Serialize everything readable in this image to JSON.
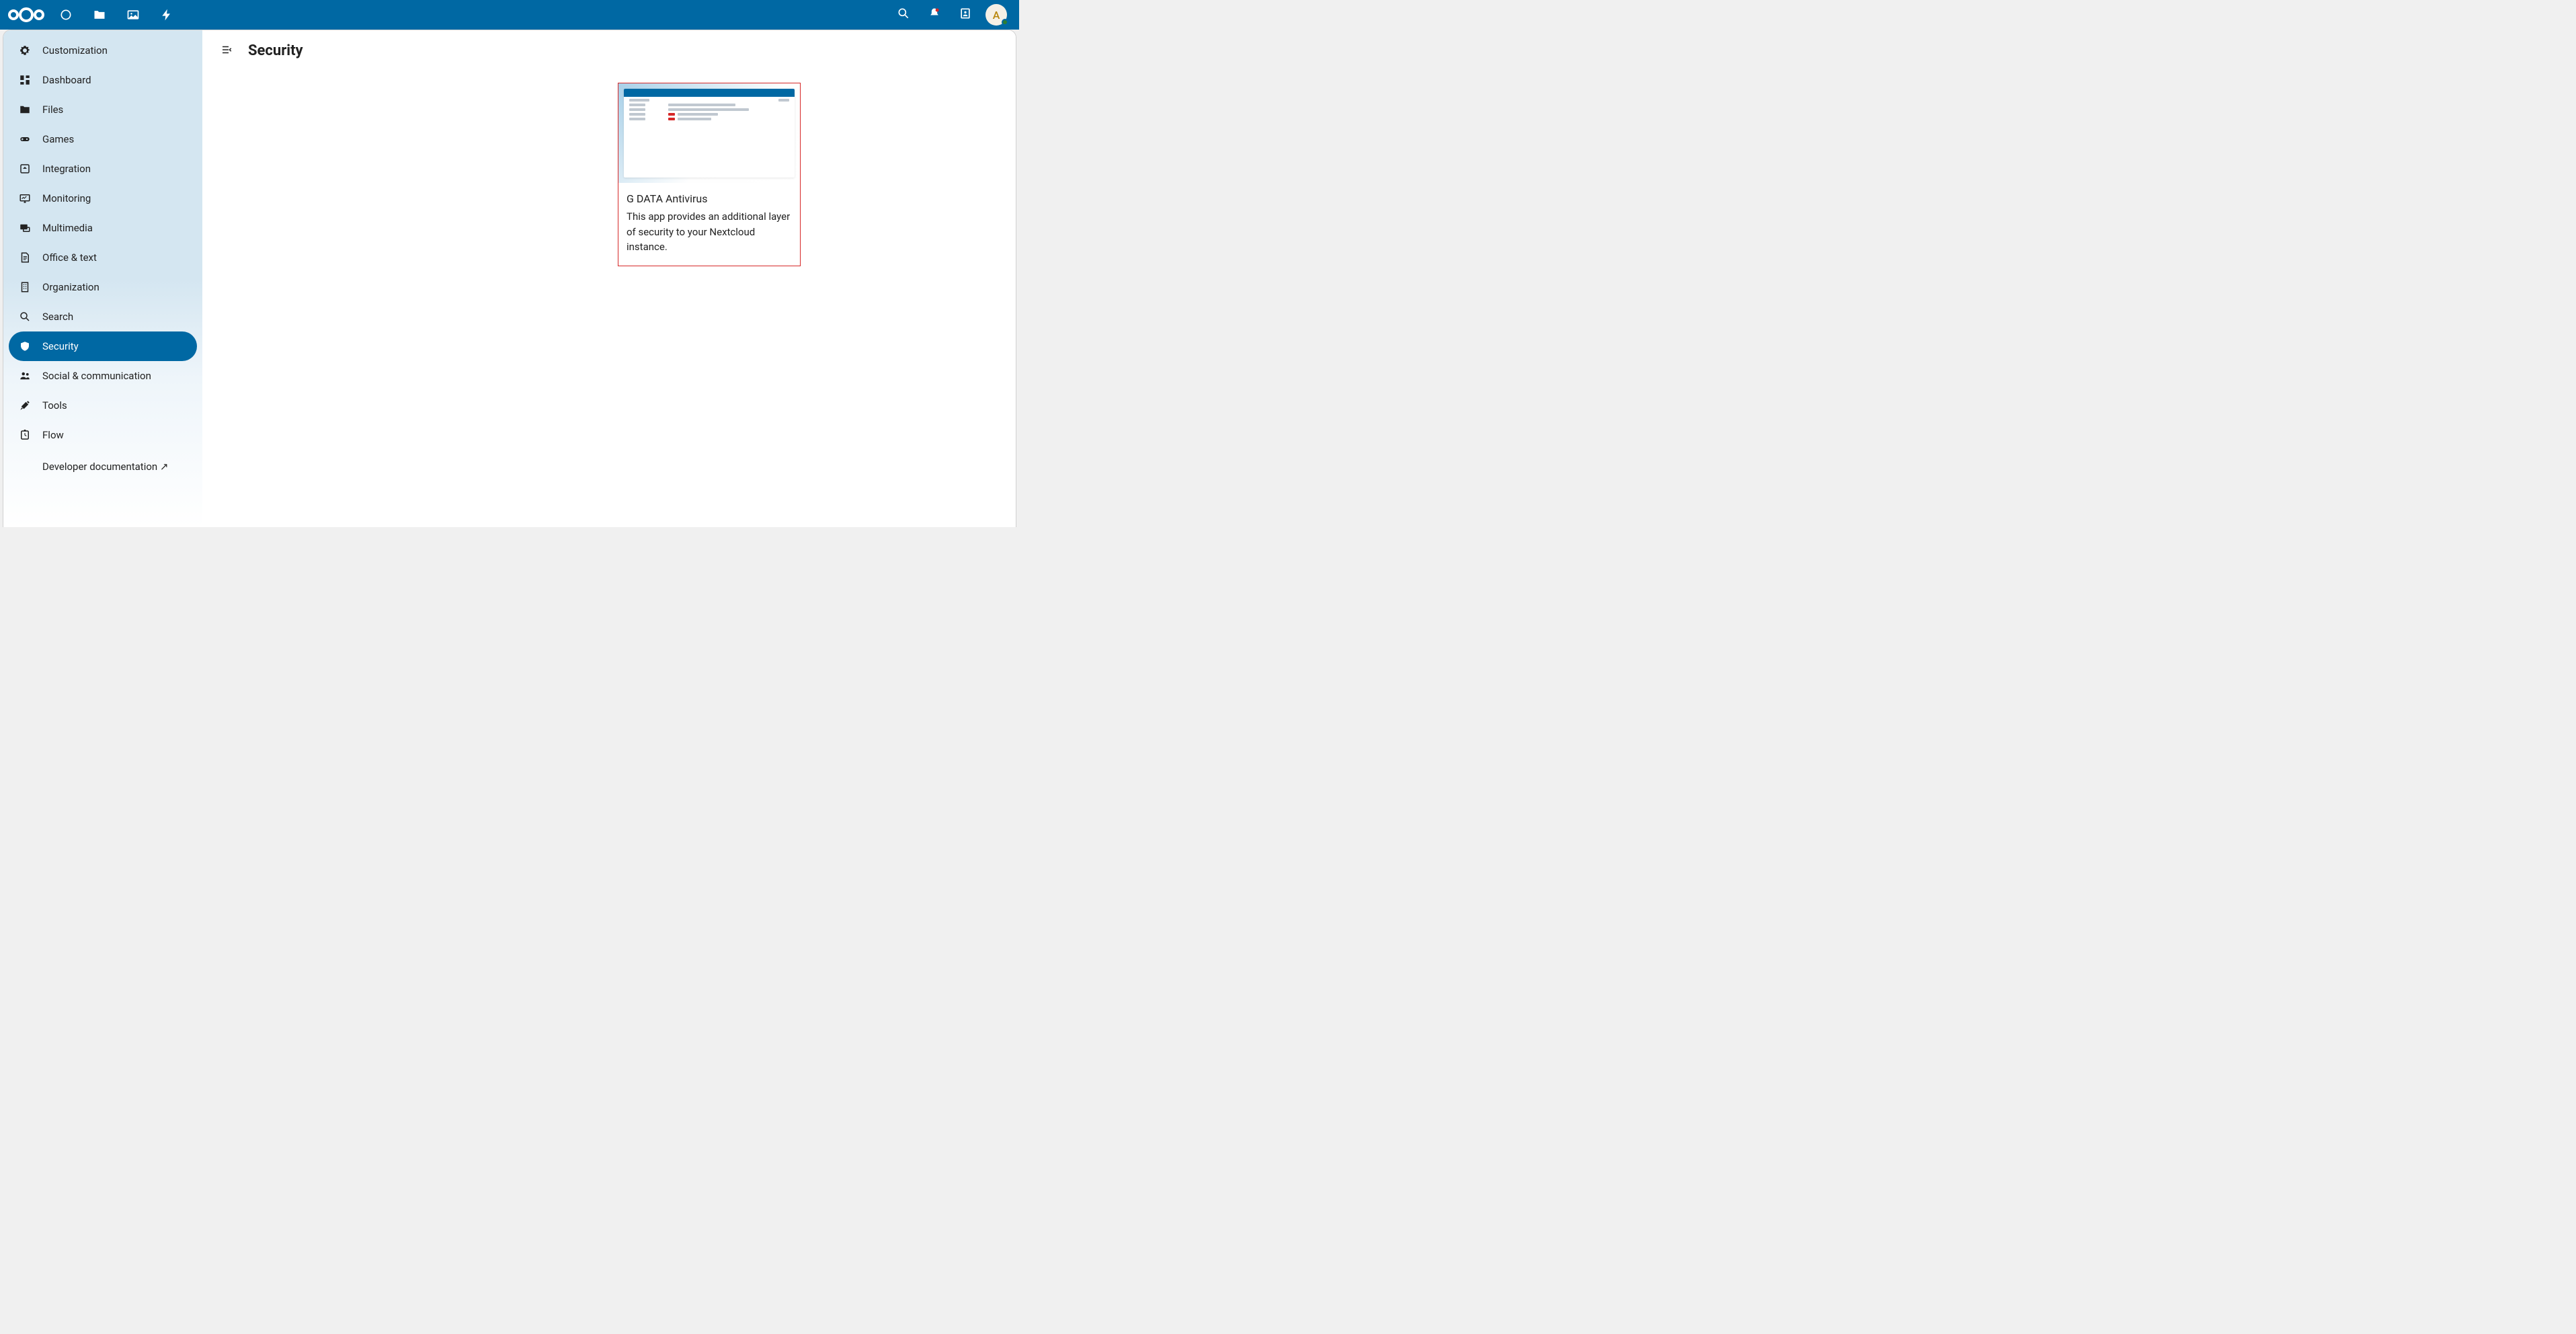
{
  "top_nav": {
    "dashboard": "Dashboard",
    "files": "Files",
    "photos": "Photos",
    "activity": "Activity"
  },
  "top_right": {
    "search": "Search",
    "notifications": "Notifications",
    "contacts": "Contacts",
    "avatar_initial": "A"
  },
  "sidebar": {
    "items": [
      {
        "label": "Customization",
        "icon": "gear"
      },
      {
        "label": "Dashboard",
        "icon": "dashboard"
      },
      {
        "label": "Files",
        "icon": "folder"
      },
      {
        "label": "Games",
        "icon": "gamepad"
      },
      {
        "label": "Integration",
        "icon": "integration"
      },
      {
        "label": "Monitoring",
        "icon": "monitor"
      },
      {
        "label": "Multimedia",
        "icon": "multimedia"
      },
      {
        "label": "Office & text",
        "icon": "office"
      },
      {
        "label": "Organization",
        "icon": "organization"
      },
      {
        "label": "Search",
        "icon": "search"
      },
      {
        "label": "Security",
        "icon": "shield",
        "active": true
      },
      {
        "label": "Social & communication",
        "icon": "people"
      },
      {
        "label": "Tools",
        "icon": "tools"
      },
      {
        "label": "Flow",
        "icon": "flow"
      },
      {
        "label": "Developer documentation ↗",
        "icon": ""
      }
    ]
  },
  "page": {
    "title": "Security"
  },
  "apps": [
    {
      "title": "G DATA Antivirus",
      "description": "This app provides an additional layer of security to your Nextcloud instance."
    }
  ],
  "colors": {
    "primary": "#0068a3",
    "accent_card_border": "#d62828"
  }
}
